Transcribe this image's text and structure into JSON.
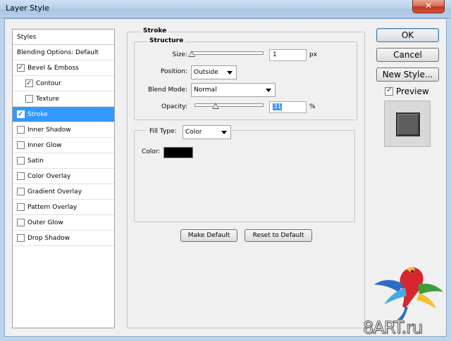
{
  "window": {
    "title": "Layer Style",
    "close_label": "✕"
  },
  "styles_list": {
    "header": "Styles",
    "blending_options": "Blending Options: Default",
    "items": [
      {
        "label": "Bevel & Emboss",
        "checked": true,
        "indent": 0,
        "selected": false
      },
      {
        "label": "Contour",
        "checked": true,
        "indent": 1,
        "selected": false
      },
      {
        "label": "Texture",
        "checked": false,
        "indent": 1,
        "selected": false
      },
      {
        "label": "Stroke",
        "checked": true,
        "indent": 0,
        "selected": true
      },
      {
        "label": "Inner Shadow",
        "checked": false,
        "indent": 0,
        "selected": false
      },
      {
        "label": "Inner Glow",
        "checked": false,
        "indent": 0,
        "selected": false
      },
      {
        "label": "Satin",
        "checked": false,
        "indent": 0,
        "selected": false
      },
      {
        "label": "Color Overlay",
        "checked": false,
        "indent": 0,
        "selected": false
      },
      {
        "label": "Gradient Overlay",
        "checked": false,
        "indent": 0,
        "selected": false
      },
      {
        "label": "Pattern Overlay",
        "checked": false,
        "indent": 0,
        "selected": false
      },
      {
        "label": "Outer Glow",
        "checked": false,
        "indent": 0,
        "selected": false
      },
      {
        "label": "Drop Shadow",
        "checked": false,
        "indent": 0,
        "selected": false
      }
    ]
  },
  "stroke": {
    "group_title": "Stroke",
    "structure_title": "Structure",
    "size_label": "Size:",
    "size_value": "1",
    "size_unit": "px",
    "size_slider_fraction": 0.0,
    "position_label": "Position:",
    "position_value": "Outside",
    "blend_mode_label": "Blend Mode:",
    "blend_mode_value": "Normal",
    "opacity_label": "Opacity:",
    "opacity_value": "31",
    "opacity_unit": "%",
    "opacity_slider_fraction": 0.31,
    "fill_type_label": "Fill Type:",
    "fill_type_value": "Color",
    "color_label": "Color:",
    "stroke_color": "#000000",
    "make_default_label": "Make Default",
    "reset_default_label": "Reset to Default"
  },
  "side_buttons": {
    "ok_label": "OK",
    "cancel_label": "Cancel",
    "new_style_label": "New Style...",
    "preview_label": "Preview",
    "preview_checked": true
  },
  "watermark": {
    "text": "8ART.ru"
  },
  "colors": {
    "selection": "#3399ff",
    "titlebar": "#b9d1ea",
    "close": "#c0391f"
  }
}
